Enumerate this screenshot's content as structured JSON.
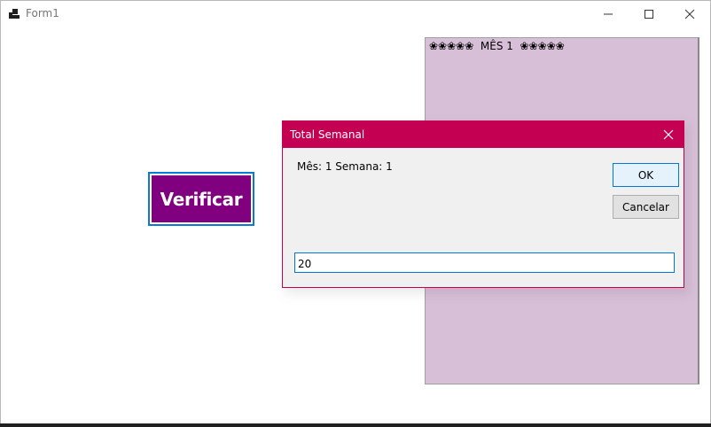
{
  "window": {
    "title": "Form1",
    "icon": "winforms-app-icon",
    "controls": [
      "minimize-icon",
      "maximize-icon",
      "close-icon"
    ]
  },
  "form": {
    "verify_button_label": "Verificar",
    "verify_button_color": "#80007f",
    "panel_color": "#d8bfd8",
    "panel_text": "❀❀❀❀❀  MÊS 1  ❀❀❀❀❀"
  },
  "dialog": {
    "title": "Total Semanal",
    "title_bar_color": "#c40053",
    "prompt": "Mês: 1 Semana: 1",
    "ok_label": "OK",
    "cancel_label": "Cancelar",
    "input_value": "20"
  }
}
